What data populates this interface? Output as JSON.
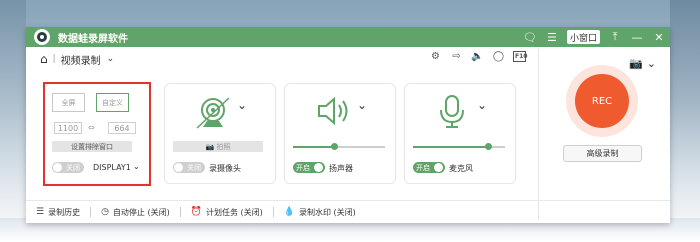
{
  "app": {
    "title": "数据蛙录屏软件"
  },
  "titlebar": {
    "mini_window": "小窗口"
  },
  "nav": {
    "breadcrumb": "视频录制",
    "separator": "|"
  },
  "screen": {
    "mode_full": "全屏",
    "mode_custom": "自定义",
    "width": "1100",
    "height": "664",
    "exclude_window_button": "设置排除窗口",
    "toggle_label": "关闭",
    "display": "DISPLAY1"
  },
  "webcam": {
    "photo_button": "拍照",
    "toggle_label": "关闭",
    "label": "录摄像头"
  },
  "speaker": {
    "toggle_label": "开启",
    "label": "扬声器",
    "volume": 0.45
  },
  "mic": {
    "toggle_label": "开启",
    "label": "麦克风",
    "volume": 0.82
  },
  "rec": {
    "label": "REC",
    "advanced": "高级录制"
  },
  "footer": {
    "history": "录制历史",
    "auto_stop": "自动停止 (关闭)",
    "schedule": "计划任务 (关闭)",
    "watermark": "录制水印 (关闭)"
  },
  "colors": {
    "brand_green": "#5fa468",
    "rec_orange": "#ef5a2e",
    "highlight_red": "#e2322e"
  }
}
